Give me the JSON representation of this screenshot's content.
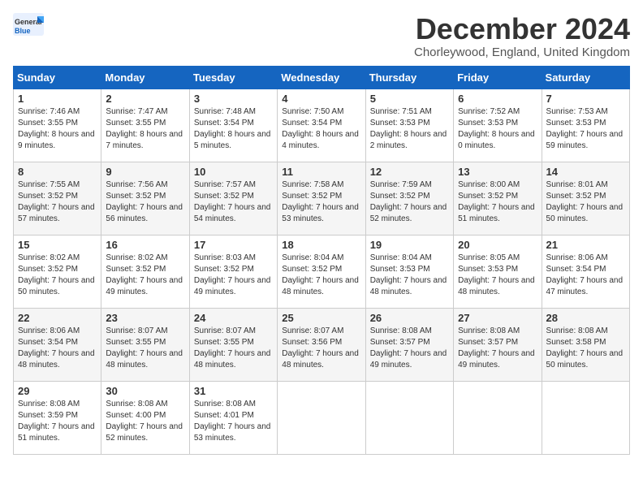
{
  "logo": {
    "line1": "General",
    "line2": "Blue"
  },
  "title": "December 2024",
  "location": "Chorleywood, England, United Kingdom",
  "days_header": [
    "Sunday",
    "Monday",
    "Tuesday",
    "Wednesday",
    "Thursday",
    "Friday",
    "Saturday"
  ],
  "weeks": [
    [
      {
        "day": "1",
        "sunrise": "Sunrise: 7:46 AM",
        "sunset": "Sunset: 3:55 PM",
        "daylight": "Daylight: 8 hours and 9 minutes."
      },
      {
        "day": "2",
        "sunrise": "Sunrise: 7:47 AM",
        "sunset": "Sunset: 3:55 PM",
        "daylight": "Daylight: 8 hours and 7 minutes."
      },
      {
        "day": "3",
        "sunrise": "Sunrise: 7:48 AM",
        "sunset": "Sunset: 3:54 PM",
        "daylight": "Daylight: 8 hours and 5 minutes."
      },
      {
        "day": "4",
        "sunrise": "Sunrise: 7:50 AM",
        "sunset": "Sunset: 3:54 PM",
        "daylight": "Daylight: 8 hours and 4 minutes."
      },
      {
        "day": "5",
        "sunrise": "Sunrise: 7:51 AM",
        "sunset": "Sunset: 3:53 PM",
        "daylight": "Daylight: 8 hours and 2 minutes."
      },
      {
        "day": "6",
        "sunrise": "Sunrise: 7:52 AM",
        "sunset": "Sunset: 3:53 PM",
        "daylight": "Daylight: 8 hours and 0 minutes."
      },
      {
        "day": "7",
        "sunrise": "Sunrise: 7:53 AM",
        "sunset": "Sunset: 3:53 PM",
        "daylight": "Daylight: 7 hours and 59 minutes."
      }
    ],
    [
      {
        "day": "8",
        "sunrise": "Sunrise: 7:55 AM",
        "sunset": "Sunset: 3:52 PM",
        "daylight": "Daylight: 7 hours and 57 minutes."
      },
      {
        "day": "9",
        "sunrise": "Sunrise: 7:56 AM",
        "sunset": "Sunset: 3:52 PM",
        "daylight": "Daylight: 7 hours and 56 minutes."
      },
      {
        "day": "10",
        "sunrise": "Sunrise: 7:57 AM",
        "sunset": "Sunset: 3:52 PM",
        "daylight": "Daylight: 7 hours and 54 minutes."
      },
      {
        "day": "11",
        "sunrise": "Sunrise: 7:58 AM",
        "sunset": "Sunset: 3:52 PM",
        "daylight": "Daylight: 7 hours and 53 minutes."
      },
      {
        "day": "12",
        "sunrise": "Sunrise: 7:59 AM",
        "sunset": "Sunset: 3:52 PM",
        "daylight": "Daylight: 7 hours and 52 minutes."
      },
      {
        "day": "13",
        "sunrise": "Sunrise: 8:00 AM",
        "sunset": "Sunset: 3:52 PM",
        "daylight": "Daylight: 7 hours and 51 minutes."
      },
      {
        "day": "14",
        "sunrise": "Sunrise: 8:01 AM",
        "sunset": "Sunset: 3:52 PM",
        "daylight": "Daylight: 7 hours and 50 minutes."
      }
    ],
    [
      {
        "day": "15",
        "sunrise": "Sunrise: 8:02 AM",
        "sunset": "Sunset: 3:52 PM",
        "daylight": "Daylight: 7 hours and 50 minutes."
      },
      {
        "day": "16",
        "sunrise": "Sunrise: 8:02 AM",
        "sunset": "Sunset: 3:52 PM",
        "daylight": "Daylight: 7 hours and 49 minutes."
      },
      {
        "day": "17",
        "sunrise": "Sunrise: 8:03 AM",
        "sunset": "Sunset: 3:52 PM",
        "daylight": "Daylight: 7 hours and 49 minutes."
      },
      {
        "day": "18",
        "sunrise": "Sunrise: 8:04 AM",
        "sunset": "Sunset: 3:52 PM",
        "daylight": "Daylight: 7 hours and 48 minutes."
      },
      {
        "day": "19",
        "sunrise": "Sunrise: 8:04 AM",
        "sunset": "Sunset: 3:53 PM",
        "daylight": "Daylight: 7 hours and 48 minutes."
      },
      {
        "day": "20",
        "sunrise": "Sunrise: 8:05 AM",
        "sunset": "Sunset: 3:53 PM",
        "daylight": "Daylight: 7 hours and 48 minutes."
      },
      {
        "day": "21",
        "sunrise": "Sunrise: 8:06 AM",
        "sunset": "Sunset: 3:54 PM",
        "daylight": "Daylight: 7 hours and 47 minutes."
      }
    ],
    [
      {
        "day": "22",
        "sunrise": "Sunrise: 8:06 AM",
        "sunset": "Sunset: 3:54 PM",
        "daylight": "Daylight: 7 hours and 48 minutes."
      },
      {
        "day": "23",
        "sunrise": "Sunrise: 8:07 AM",
        "sunset": "Sunset: 3:55 PM",
        "daylight": "Daylight: 7 hours and 48 minutes."
      },
      {
        "day": "24",
        "sunrise": "Sunrise: 8:07 AM",
        "sunset": "Sunset: 3:55 PM",
        "daylight": "Daylight: 7 hours and 48 minutes."
      },
      {
        "day": "25",
        "sunrise": "Sunrise: 8:07 AM",
        "sunset": "Sunset: 3:56 PM",
        "daylight": "Daylight: 7 hours and 48 minutes."
      },
      {
        "day": "26",
        "sunrise": "Sunrise: 8:08 AM",
        "sunset": "Sunset: 3:57 PM",
        "daylight": "Daylight: 7 hours and 49 minutes."
      },
      {
        "day": "27",
        "sunrise": "Sunrise: 8:08 AM",
        "sunset": "Sunset: 3:57 PM",
        "daylight": "Daylight: 7 hours and 49 minutes."
      },
      {
        "day": "28",
        "sunrise": "Sunrise: 8:08 AM",
        "sunset": "Sunset: 3:58 PM",
        "daylight": "Daylight: 7 hours and 50 minutes."
      }
    ],
    [
      {
        "day": "29",
        "sunrise": "Sunrise: 8:08 AM",
        "sunset": "Sunset: 3:59 PM",
        "daylight": "Daylight: 7 hours and 51 minutes."
      },
      {
        "day": "30",
        "sunrise": "Sunrise: 8:08 AM",
        "sunset": "Sunset: 4:00 PM",
        "daylight": "Daylight: 7 hours and 52 minutes."
      },
      {
        "day": "31",
        "sunrise": "Sunrise: 8:08 AM",
        "sunset": "Sunset: 4:01 PM",
        "daylight": "Daylight: 7 hours and 53 minutes."
      },
      null,
      null,
      null,
      null
    ]
  ]
}
